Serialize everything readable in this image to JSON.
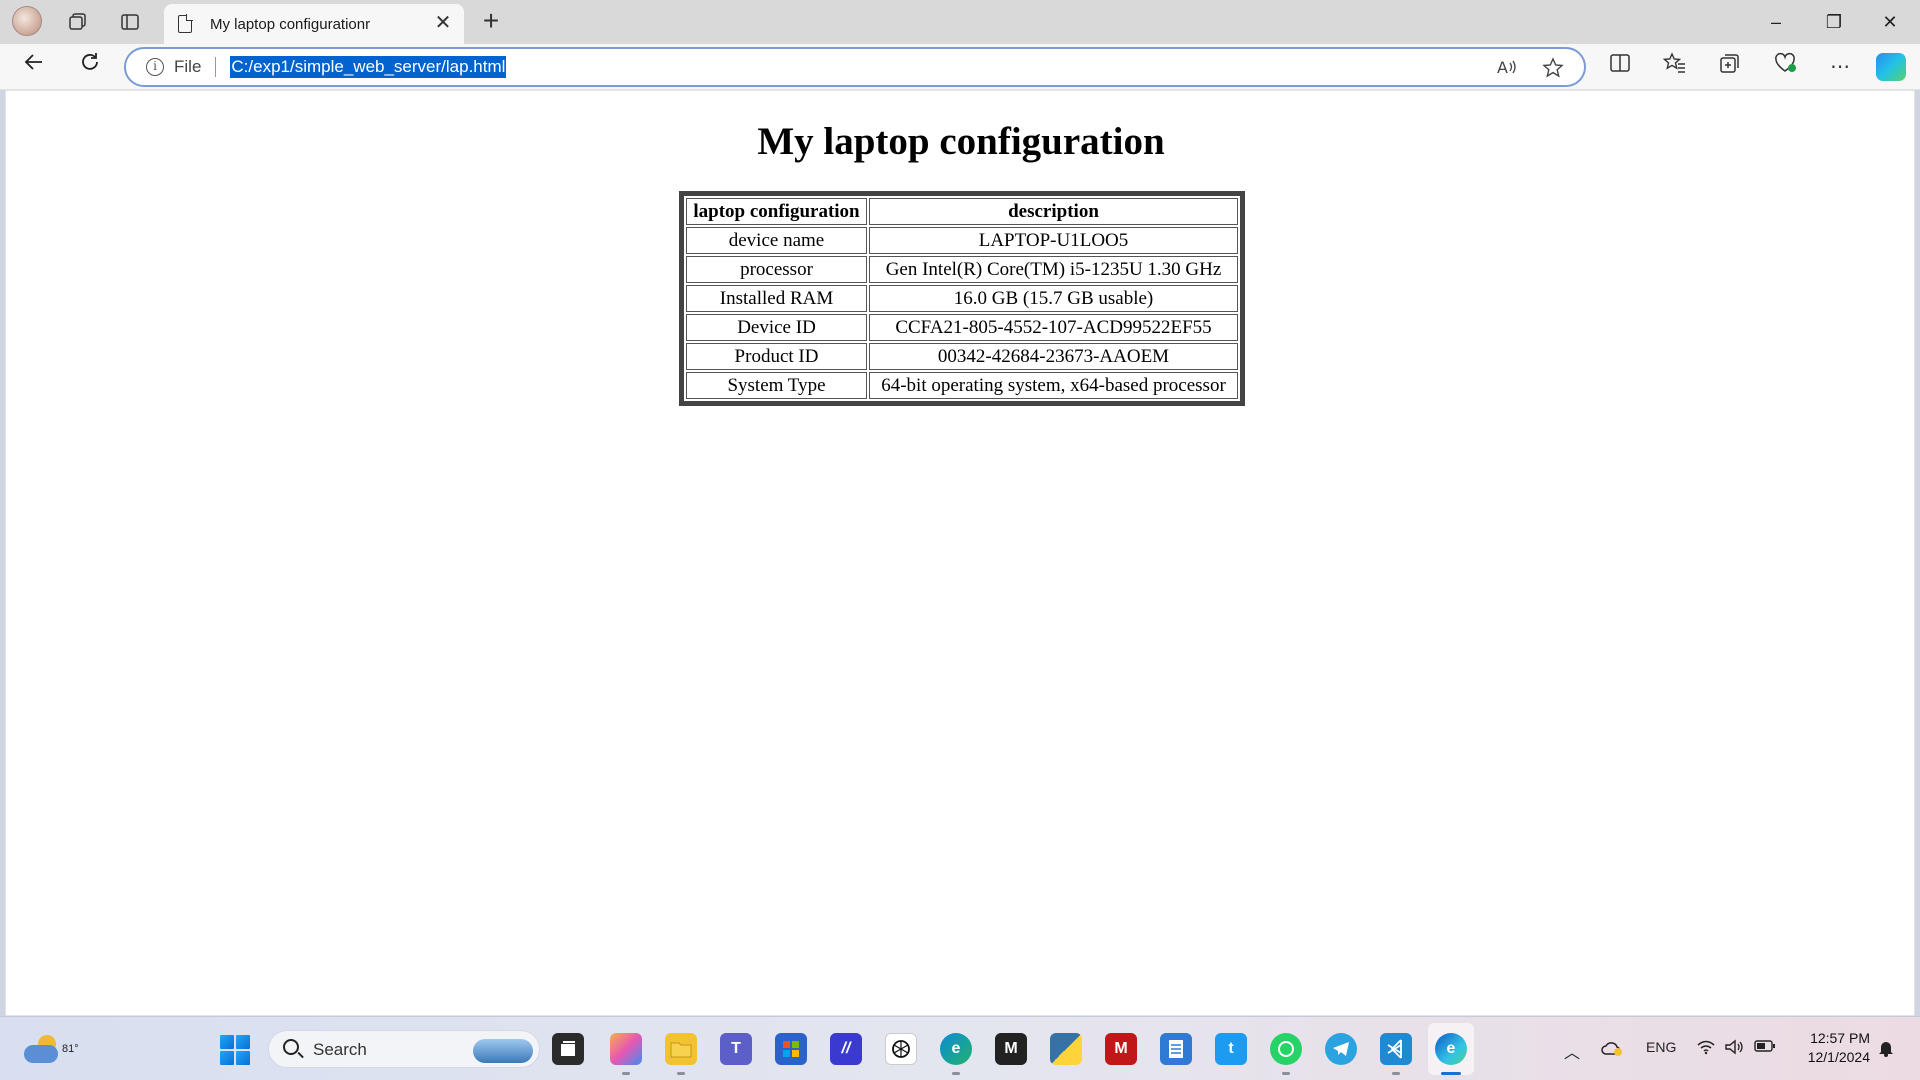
{
  "browser": {
    "tab_title": "My laptop configurationr",
    "tab_close": "✕",
    "new_tab": "+",
    "address": {
      "info_icon": "i",
      "scheme_label": "File",
      "url": "C:/exp1/simple_web_server/lap.html"
    },
    "window_controls": {
      "minimize": "–",
      "restore": "❐",
      "close": "✕"
    }
  },
  "page": {
    "heading": "My laptop configuration",
    "table": {
      "headers": [
        "laptop configuration",
        "description"
      ],
      "rows": [
        [
          "device name",
          "LAPTOP-U1LOO5"
        ],
        [
          "processor",
          "Gen Intel(R) Core(TM) i5-1235U 1.30 GHz"
        ],
        [
          "Installed RAM",
          "16.0 GB (15.7 GB usable)"
        ],
        [
          "Device ID",
          "CCFA21-805-4552-107-ACD99522EF55"
        ],
        [
          "Product ID",
          "00342-42684-23673-AAOEM"
        ],
        [
          "System Type",
          "64-bit operating system, x64-based processor"
        ]
      ]
    }
  },
  "taskbar": {
    "weather_temp": "81°",
    "search_placeholder": "Search",
    "tray": {
      "language": "ENG",
      "time": "12:57 PM",
      "date": "12/1/2024"
    },
    "apps": [
      "copilot-app-icon",
      "file-explorer-icon",
      "teams-icon",
      "store-icon",
      "editor-app-icon",
      "chatgpt-icon",
      "edge-beta-icon",
      "medium-icon",
      "python-icon",
      "mcafee-icon",
      "notepad-icon",
      "twitter-icon",
      "whatsapp-icon",
      "telegram-icon",
      "vscode-icon",
      "edge-icon"
    ]
  },
  "colors": {
    "url_highlight": "#0063cf",
    "address_border": "#7a9bd6",
    "accent": "#1a6fd0"
  }
}
